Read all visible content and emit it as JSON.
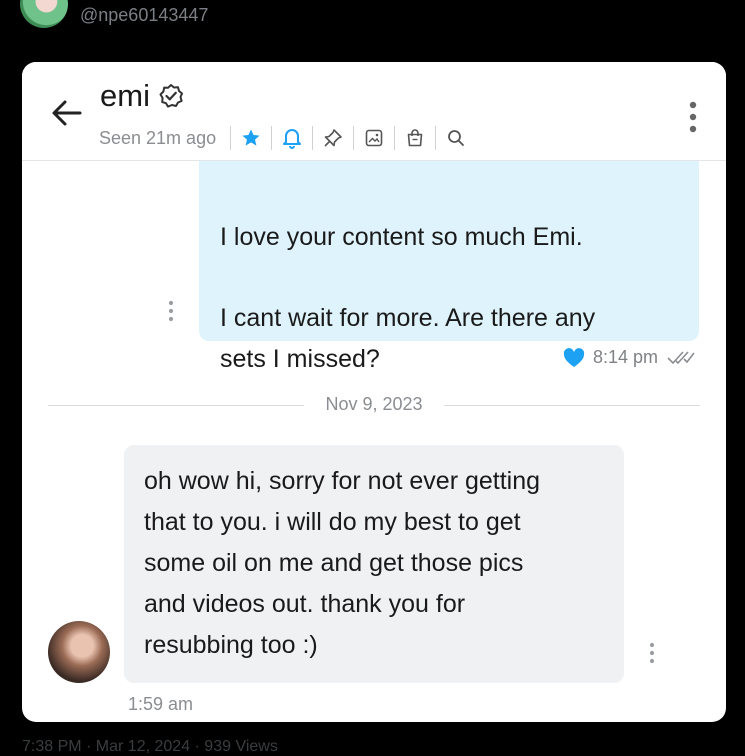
{
  "post": {
    "handle": "@npe60143447",
    "bottom_meta": "7:38 PM · Mar 12, 2024 · 939 Views"
  },
  "chat": {
    "contact_name": "emi",
    "seen": "Seen 21m ago",
    "toolbar_icons": [
      "star-icon",
      "bell-icon",
      "pin-icon",
      "image-icon",
      "bag-icon",
      "search-icon"
    ],
    "accent_color": "#1da1f2",
    "messages": [
      {
        "direction": "outgoing",
        "lines": [
          "I love your content so much Emi.",
          "I cant wait for more. Are there any",
          "sets I missed?"
        ],
        "time": "8:14 pm",
        "liked": true,
        "bubble_color": "#dff3fc"
      },
      {
        "direction": "incoming",
        "lines": [
          "oh wow hi, sorry for not ever getting",
          "that to you. i will do my best to get",
          "some oil on me and get those pics",
          "and videos out. thank you for",
          "resubbing too :)"
        ],
        "time": "1:59 am",
        "bubble_color": "#f0f1f3"
      }
    ],
    "date_separator": "Nov 9, 2023"
  }
}
